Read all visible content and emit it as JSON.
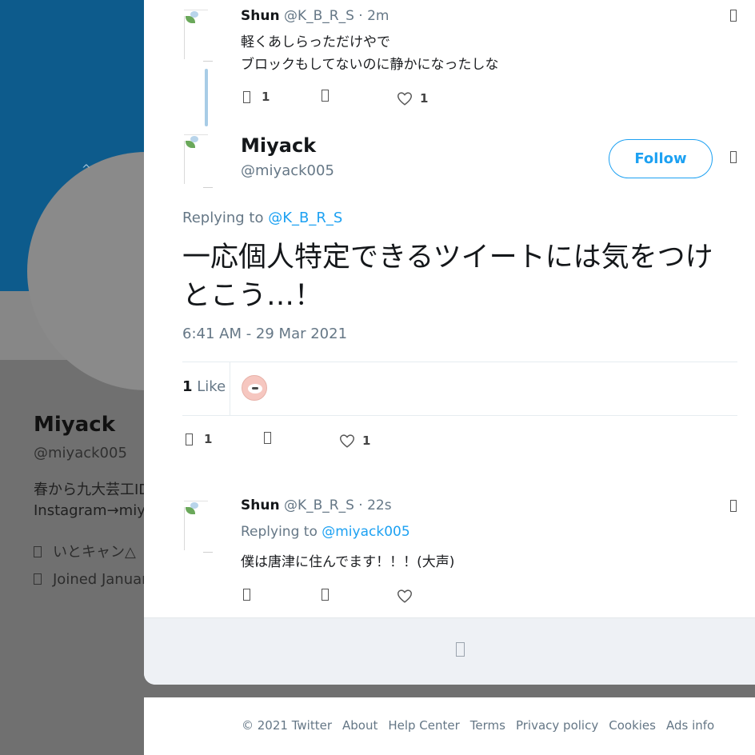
{
  "background_profile": {
    "name": "Miyack",
    "handle": "@miyack005",
    "bio_line1": "春から九大芸工ID",
    "bio_line2": "Instagram→miyac",
    "location": "いとキャン△",
    "joined": "Joined Januar",
    "avatar_mark": "^"
  },
  "thread": {
    "parent_tweet": {
      "name": "Shun",
      "handle": "@K_B_R_S",
      "time": "· 2m",
      "text_line1": "軽くあしらっただけやで",
      "text_line2": "ブロックもしてないのに静かになったしな",
      "reply_count": "1",
      "like_count": "1"
    },
    "main_tweet": {
      "name": "Miyack",
      "handle": "@miyack005",
      "follow_label": "Follow",
      "replying_prefix": "Replying to",
      "replying_to": "@K_B_R_S",
      "text": "一応個人特定できるツイートには気をつけとこう…！",
      "timestamp": "6:41 AM - 29 Mar 2021",
      "likes_number": "1",
      "likes_label": "Like",
      "reply_count": "1",
      "like_count": "1"
    },
    "reply_tweet": {
      "name": "Shun",
      "handle": "@K_B_R_S",
      "time": "· 22s",
      "replying_prefix": "Replying to",
      "replying_to": "@miyack005",
      "text": "僕は唐津に住んでます！！！(大声)"
    }
  },
  "footer": {
    "links": [
      "© 2021 Twitter",
      "About",
      "Help Center",
      "Terms",
      "Privacy policy",
      "Cookies",
      "Ads info"
    ]
  },
  "colors": {
    "banner": "#0d5b8c",
    "accent": "#1da1f2",
    "secondary_text": "#657786",
    "thread_line": "#a8cce6"
  },
  "icons": [
    "reply-icon",
    "retweet-icon",
    "heart-icon",
    "caret-down-icon",
    "location-icon",
    "calendar-icon",
    "more-replies-icon"
  ]
}
